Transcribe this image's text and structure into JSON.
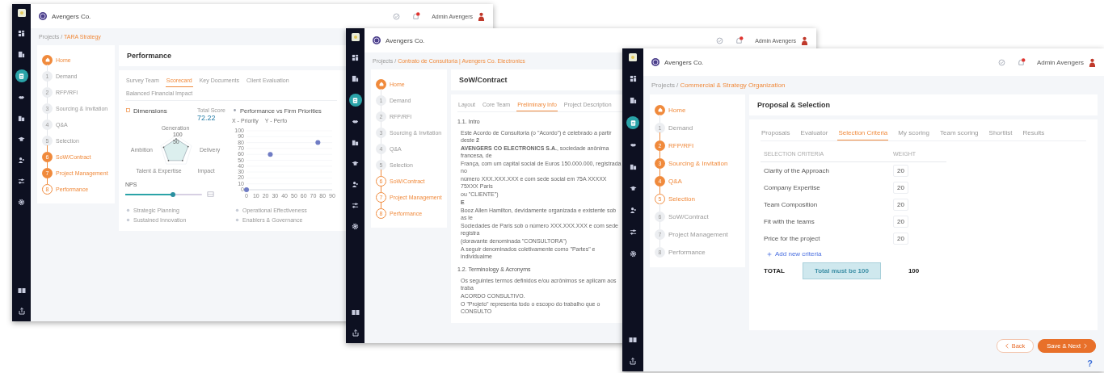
{
  "windows": [
    {
      "kind": "performance",
      "brand": "Avengers Co.",
      "user": "Admin Avengers",
      "sidebar": [
        {
          "selected": false
        },
        {
          "selected": false
        },
        {
          "selected": true
        },
        {
          "selected": false
        },
        {
          "selected": false
        },
        {
          "selected": false
        },
        {
          "selected": false
        },
        {
          "selected": false
        },
        {
          "selected": false
        }
      ],
      "breadcrumb": {
        "root": "Projects /",
        "current": "TARA Strategy"
      },
      "steps": [
        {
          "label": "Home",
          "done": true,
          "current": false
        },
        {
          "number": "1",
          "label": "Demand",
          "done": false,
          "current": false
        },
        {
          "number": "2",
          "label": "RFP/RFI",
          "done": false,
          "current": false
        },
        {
          "number": "3",
          "label": "Sourcing & Invitation",
          "done": false,
          "current": false
        },
        {
          "number": "4",
          "label": "Q&A",
          "done": false,
          "current": false
        },
        {
          "number": "5",
          "label": "Selection",
          "done": false,
          "current": false
        },
        {
          "number": "6",
          "label": "SoW/Contract",
          "done": true,
          "current": false
        },
        {
          "number": "7",
          "label": "Project Management",
          "done": true,
          "current": false
        },
        {
          "number": "8",
          "label": "Performance",
          "done": false,
          "current": true
        }
      ],
      "title": "Performance",
      "tabs": [
        {
          "label": "Survey Team",
          "selected": false
        },
        {
          "label": "Scorecard",
          "selected": true
        },
        {
          "label": "Key Documents",
          "selected": false
        },
        {
          "label": "Client Evaluation",
          "selected": false
        },
        {
          "label": "Balanced Financial Impact",
          "selected": false
        }
      ],
      "dimensions": {
        "title": "Dimensions",
        "score_label": "Total Score",
        "score": "72.22",
        "axes": [
          "Generation",
          "Ambition",
          "Delivery",
          "Talent & Expertise",
          "Impact"
        ],
        "rings": [
          "100",
          "50"
        ]
      },
      "scatter": {
        "title": "Performance vs Firm Priorities",
        "legend": [
          "X - Priority",
          "Y - Perfo"
        ],
        "chart_data": {
          "type": "scatter",
          "grid": true,
          "xlim": [
            0,
            90
          ],
          "ylim": [
            0,
            100
          ],
          "xticks": [
            0,
            10,
            20,
            30,
            40,
            50,
            60,
            70,
            80,
            90
          ],
          "yticks": [
            0,
            10,
            20,
            30,
            40,
            50,
            60,
            70,
            80,
            90,
            100
          ],
          "x": [
            25,
            75,
            0
          ],
          "series": [
            {
              "color": "#6f7cc4",
              "values": [
                60,
                80,
                0
              ]
            }
          ]
        }
      },
      "nps": {
        "label": "NPS",
        "level": 0.62
      },
      "priorities": [
        "Strategic Planning",
        "Operational Effectiveness",
        "Sustained Innovation",
        "Enablers & Governance"
      ]
    },
    {
      "kind": "contract",
      "brand": "Avengers Co.",
      "user": "Admin Avengers",
      "sidebar": [
        {
          "selected": false
        },
        {
          "selected": false
        },
        {
          "selected": true
        },
        {
          "selected": false
        },
        {
          "selected": false
        },
        {
          "selected": false
        },
        {
          "selected": false
        },
        {
          "selected": false
        },
        {
          "selected": false
        }
      ],
      "breadcrumb": {
        "root": "Projects /",
        "current": "Contrato de Consultoria | Avengers Co. Electronics"
      },
      "steps": [
        {
          "label": "Home",
          "done": true,
          "current": false
        },
        {
          "number": "1",
          "label": "Demand",
          "done": false,
          "current": false
        },
        {
          "number": "2",
          "label": "RFP/RFI",
          "done": false,
          "current": false
        },
        {
          "number": "3",
          "label": "Sourcing & Invitation",
          "done": false,
          "current": false
        },
        {
          "number": "4",
          "label": "Q&A",
          "done": false,
          "current": false
        },
        {
          "number": "5",
          "label": "Selection",
          "done": false,
          "current": false
        },
        {
          "number": "6",
          "label": "SoW/Contract",
          "done": false,
          "current": true
        },
        {
          "number": "7",
          "label": "Project Management",
          "done": false,
          "current": true
        },
        {
          "number": "8",
          "label": "Performance",
          "done": false,
          "current": true
        }
      ],
      "title": "SoW/Contract",
      "tabs": [
        {
          "label": "Layout",
          "selected": false
        },
        {
          "label": "Core Team",
          "selected": false
        },
        {
          "label": "Preliminary Info",
          "selected": true
        },
        {
          "label": "Project Description",
          "selected": false
        }
      ],
      "sections": [
        {
          "heading": "1.1. Intro",
          "lines": [
            "Este Acordo de Consultoria (o \"Acordo\") é celebrado a partir deste **2**",
            "**AVENGERS CO ELECTRONICS S.A.**, sociedade anônima francesa, de",
            "França, com um capital social de Euros 150.000.000, registrada no",
            "número XXX.XXX.XXX e com sede social em 75A XXXXX 75XXX Paris",
            "ou \"CLIENTE\")",
            "**E**",
            "Booz Allen Hamilton, devidamente organizada e existente sob as le",
            "Sociedades de Paris sob o número XXX.XXX.XXX e com sede registra",
            "(doravante denominada \"CONSULTORA\")",
            "A seguir denominados coletivamente como \"Partes\" e individualme"
          ]
        },
        {
          "heading": "1.2. Terminology & Acronyms",
          "lines": [
            "Os seguintes termos definidos e/ou acrônimos se aplicam aos traba",
            "ACORDO CONSULTIVO.",
            "O \"Projeto\" representa todo o escopo do trabalho que o CONSULTO"
          ]
        }
      ]
    },
    {
      "kind": "selection",
      "brand": "Avengers Co.",
      "user": "Admin Avengers",
      "sidebar": [
        {
          "selected": false
        },
        {
          "selected": false
        },
        {
          "selected": true
        },
        {
          "selected": false
        },
        {
          "selected": false
        },
        {
          "selected": false
        },
        {
          "selected": false
        },
        {
          "selected": false
        },
        {
          "selected": false
        }
      ],
      "breadcrumb": {
        "root": "Projects /",
        "current": "Commercial & Strategy Organization"
      },
      "steps": [
        {
          "label": "Home",
          "done": true,
          "current": false
        },
        {
          "number": "1",
          "label": "Demand",
          "done": false,
          "current": false
        },
        {
          "number": "2",
          "label": "RFP/RFI",
          "done": true,
          "current": false
        },
        {
          "number": "3",
          "label": "Sourcing & Invitation",
          "done": true,
          "current": false
        },
        {
          "number": "4",
          "label": "Q&A",
          "done": true,
          "current": false
        },
        {
          "number": "5",
          "label": "Selection",
          "done": false,
          "current": true
        },
        {
          "number": "6",
          "label": "SoW/Contract",
          "done": false,
          "current": false
        },
        {
          "number": "7",
          "label": "Project Management",
          "done": false,
          "current": false
        },
        {
          "number": "8",
          "label": "Performance",
          "done": false,
          "current": false
        }
      ],
      "title": "Proposal & Selection",
      "tabs": [
        {
          "label": "Proposals",
          "selected": false
        },
        {
          "label": "Evaluator",
          "selected": false
        },
        {
          "label": "Selection Criteria",
          "selected": true
        },
        {
          "label": "My scoring",
          "selected": false
        },
        {
          "label": "Team scoring",
          "selected": false
        },
        {
          "label": "Shortlist",
          "selected": false
        },
        {
          "label": "Results",
          "selected": false
        }
      ],
      "table": {
        "columns": [
          "SELECTION CRITERIA",
          "WEIGHT"
        ],
        "rows": [
          {
            "criterion": "Clarity of the Approach",
            "weight": "20"
          },
          {
            "criterion": "Company Expertise",
            "weight": "20"
          },
          {
            "criterion": "Team Composition",
            "weight": "20"
          },
          {
            "criterion": "Fit with the teams",
            "weight": "20"
          },
          {
            "criterion": "Price for the project",
            "weight": "20"
          }
        ]
      },
      "add_link": "Add new criteria",
      "total": {
        "label": "TOTAL",
        "message": "Total must be 100",
        "value": "100"
      },
      "buttons": {
        "back": "Back",
        "next": "Save & Next",
        "help": "?"
      }
    }
  ]
}
